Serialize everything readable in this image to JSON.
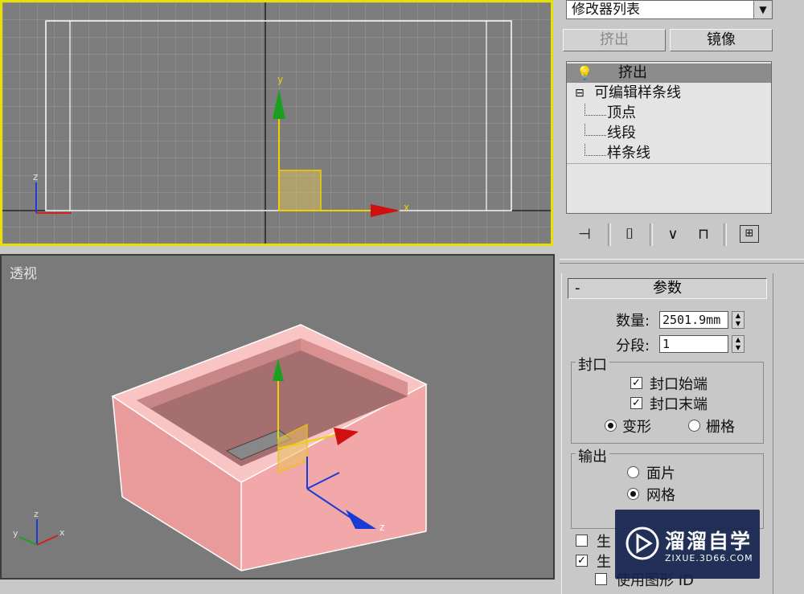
{
  "viewports": {
    "front": {
      "axis_x": "x",
      "axis_y": "y",
      "mini_axis_z": "z"
    },
    "perspective": {
      "label": "透视",
      "axis_z": "z",
      "mini_axis_x": "x",
      "mini_axis_y": "y",
      "mini_axis_z": "z"
    }
  },
  "panel": {
    "modifier_list": "修改器列表",
    "buttons": {
      "extrude": "挤出",
      "mirror": "镜像"
    },
    "stack": {
      "extrude": "挤出",
      "editable_spline": "可编辑样条线",
      "sub_vertex": "顶点",
      "sub_segment": "线段",
      "sub_spline": "样条线"
    },
    "parameters": {
      "title": "参数",
      "collapse": "-",
      "amount_label": "数量:",
      "amount_value": "2501.9mm",
      "segments_label": "分段:",
      "segments_value": "1",
      "capping": {
        "title": "封口",
        "cap_start": "封口始端",
        "cap_end": "封口末端",
        "morph": "变形",
        "grid": "栅格"
      },
      "output": {
        "title": "输出",
        "patch": "面片",
        "mesh": "网格"
      },
      "partial": {
        "gen1": "生",
        "gen2": "生",
        "use_shape_id": "使用图形 ID"
      }
    }
  },
  "watermark": {
    "brand": "溜溜自学",
    "url": "ZIXUE.3D66.COM"
  },
  "colors": {
    "viewport_bg": "#7a7a7a",
    "active_border": "#e8e000",
    "box_fill": "#f0a8a8",
    "panel_bg": "#c8c8c8"
  }
}
